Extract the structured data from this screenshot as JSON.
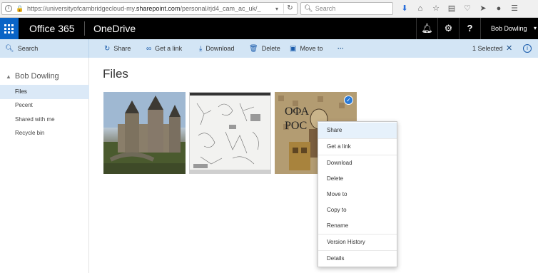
{
  "browser": {
    "url_prefix": "https://universityofcambridgecloud-my.",
    "url_domain": "sharepoint.com",
    "url_suffix": "/personal/rjd4_cam_ac_uk/_",
    "search_placeholder": "Search",
    "icons": [
      "download-icon",
      "home-icon",
      "star-icon",
      "reading-list-icon",
      "pocket-icon",
      "send-icon",
      "chat-icon",
      "menu-icon"
    ]
  },
  "header": {
    "brand": "Office 365",
    "app": "OneDrive",
    "user": "Bob Dowling",
    "icons": [
      "bell-icon",
      "gear-icon",
      "help-icon"
    ]
  },
  "commandbar": {
    "search": "Search",
    "share": "Share",
    "get_link": "Get a link",
    "download": "Download",
    "delete": "Delete",
    "move_to": "Move to",
    "more": "···",
    "selected": "1 Selected"
  },
  "nav": {
    "user": "Bob Dowling",
    "items": [
      {
        "label": "Files",
        "active": true
      },
      {
        "label": "Pecent",
        "active": false
      },
      {
        "label": "Shared with me",
        "active": false
      },
      {
        "label": "Recycle bin",
        "active": false
      }
    ]
  },
  "main": {
    "title": "Files"
  },
  "context_menu": {
    "items": [
      "Share",
      "Get a link",
      "Download",
      "Delete",
      "Move to",
      "Copy to",
      "Rename",
      "Version History",
      "Details"
    ]
  },
  "colors": {
    "accent": "#0a64c6",
    "header": "#000000",
    "commandbar": "#d3e5f5"
  }
}
